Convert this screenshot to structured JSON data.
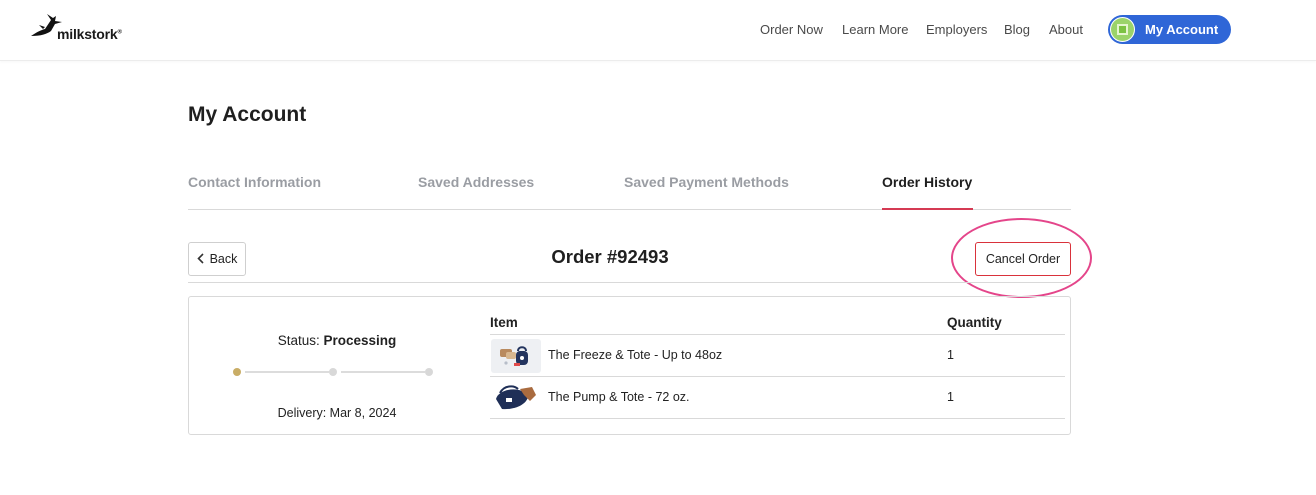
{
  "brand": {
    "name": "milkstork",
    "reg": "®"
  },
  "nav": {
    "links": [
      "Order Now",
      "Learn More",
      "Employers",
      "Blog",
      "About"
    ],
    "account_label": "My Account"
  },
  "page": {
    "title": "My Account"
  },
  "tabs": [
    {
      "label": "Contact Information",
      "active": false
    },
    {
      "label": "Saved Addresses",
      "active": false
    },
    {
      "label": "Saved Payment Methods",
      "active": false
    },
    {
      "label": "Order History",
      "active": true
    }
  ],
  "order": {
    "back_label": "Back",
    "title": "Order #92493",
    "cancel_label": "Cancel Order",
    "status_label": "Status:",
    "status_value": "Processing",
    "delivery": "Delivery: Mar 8, 2024",
    "progress_steps_total": 3,
    "progress_steps_done": 1,
    "columns": {
      "item": "Item",
      "quantity": "Quantity"
    },
    "items": [
      {
        "name": "The Freeze & Tote - Up to 48oz",
        "quantity": "1",
        "thumb_icon": "freeze-tote-product-icon"
      },
      {
        "name": "The Pump & Tote - 72 oz.",
        "quantity": "1",
        "thumb_icon": "pump-tote-product-icon"
      }
    ]
  },
  "colors": {
    "accent_blue": "#2f66d7",
    "tab_underline": "#d53a53",
    "cancel_border": "#d9323b",
    "highlight_ring": "#e4458a",
    "progress_done": "#c9ad66"
  }
}
